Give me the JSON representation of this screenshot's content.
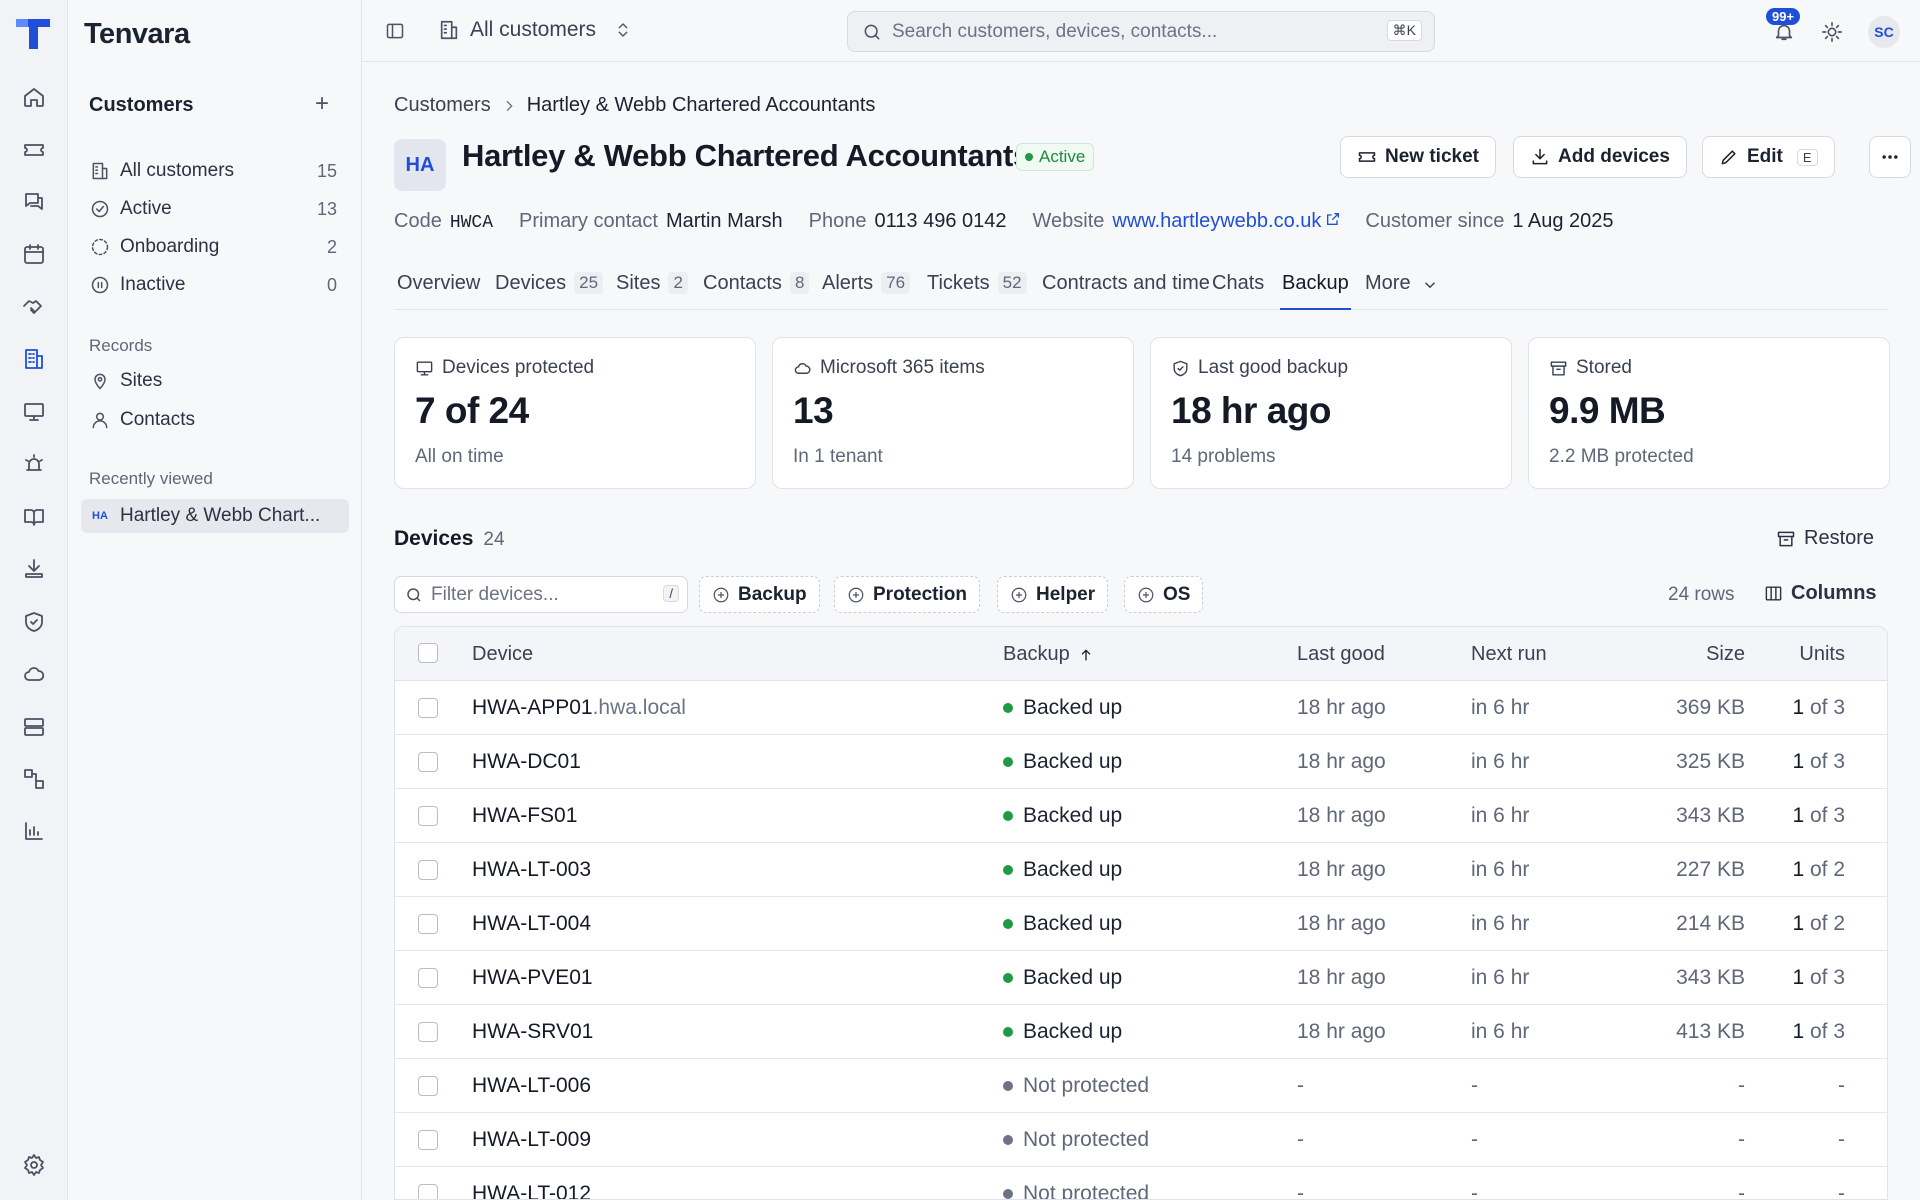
{
  "app": {
    "brand": "Tenvara"
  },
  "rail": {
    "icons": [
      "home-icon",
      "ticket-icon",
      "chat-icon",
      "calendar-icon",
      "handshake-icon",
      "building-icon",
      "monitor-icon",
      "alarm-icon",
      "book-icon",
      "download-icon",
      "shield-icon",
      "cloud-icon",
      "server-icon",
      "workflow-icon",
      "chart-icon",
      "settings-icon"
    ],
    "active": "building-icon"
  },
  "sidebar": {
    "title": "Customers",
    "items": [
      {
        "label": "All customers",
        "count": "15",
        "icon": "building-icon"
      },
      {
        "label": "Active",
        "count": "13",
        "icon": "check-circle-icon"
      },
      {
        "label": "Onboarding",
        "count": "2",
        "icon": "dashed-circle-icon"
      },
      {
        "label": "Inactive",
        "count": "0",
        "icon": "pause-circle-icon"
      }
    ],
    "records_label": "Records",
    "records": [
      {
        "label": "Sites",
        "icon": "pin-icon"
      },
      {
        "label": "Contacts",
        "icon": "user-icon"
      }
    ],
    "recent_label": "Recently viewed",
    "recent": [
      {
        "badge": "HA",
        "label": "Hartley & Webb Chart..."
      }
    ]
  },
  "topbar": {
    "scope": "All customers",
    "search_placeholder": "Search customers, devices, contacts...",
    "search_shortcut": "⌘K",
    "notifications_badge": "99+",
    "avatar": "SC"
  },
  "breadcrumb": {
    "root": "Customers",
    "current": "Hartley & Webb Chartered Accountants"
  },
  "customer": {
    "initials": "HA",
    "name": "Hartley & Webb Chartered Accountants",
    "status": "Active",
    "actions": {
      "new_ticket": "New ticket",
      "add_devices": "Add devices",
      "edit": "Edit",
      "edit_key": "E"
    },
    "meta": {
      "code_label": "Code",
      "code": "HWCA",
      "contact_label": "Primary contact",
      "contact": "Martin Marsh",
      "phone_label": "Phone",
      "phone": "0113 496 0142",
      "website_label": "Website",
      "website": "www.hartleywebb.co.uk",
      "since_label": "Customer since",
      "since": "1 Aug 2025"
    }
  },
  "tabs": [
    {
      "label": "Overview",
      "count": ""
    },
    {
      "label": "Devices",
      "count": "25"
    },
    {
      "label": "Sites",
      "count": "2"
    },
    {
      "label": "Contacts",
      "count": "8"
    },
    {
      "label": "Alerts",
      "count": "76"
    },
    {
      "label": "Tickets",
      "count": "52"
    },
    {
      "label": "Contracts and time",
      "count": ""
    },
    {
      "label": "Chats",
      "count": ""
    },
    {
      "label": "Backup",
      "count": ""
    },
    {
      "label": "More",
      "count": ""
    }
  ],
  "active_tab": "Backup",
  "stats": [
    {
      "label": "Devices protected",
      "value": "7 of 24",
      "sub": "All on time",
      "icon": "monitor-icon"
    },
    {
      "label": "Microsoft 365 items",
      "value": "13",
      "sub": "In 1 tenant",
      "icon": "cloud-icon"
    },
    {
      "label": "Last good backup",
      "value": "18 hr ago",
      "sub": "14 problems",
      "icon": "shield-check-icon"
    },
    {
      "label": "Stored",
      "value": "9.9 MB",
      "sub": "2.2 MB protected",
      "icon": "archive-icon"
    }
  ],
  "devices": {
    "title": "Devices",
    "count": "24",
    "restore_label": "Restore",
    "filter_placeholder": "Filter devices...",
    "filter_key": "/",
    "chips": [
      "Backup",
      "Protection",
      "Helper",
      "OS"
    ],
    "rows_label": "24 rows",
    "columns_label": "Columns",
    "headers": {
      "device": "Device",
      "backup": "Backup",
      "last_good": "Last good",
      "next_run": "Next run",
      "size": "Size",
      "units": "Units"
    },
    "status_colors": {
      "Backed up": "#1f9a45",
      "Not protected": "#6b7384"
    },
    "rows": [
      {
        "device": "HWA-APP01",
        "suffix": ".hwa.local",
        "backup": "Backed up",
        "last_good": "18 hr ago",
        "next_run": "in 6 hr",
        "size": "369 KB",
        "units_a": "1",
        "units_b": "of 3"
      },
      {
        "device": "HWA-DC01",
        "suffix": "",
        "backup": "Backed up",
        "last_good": "18 hr ago",
        "next_run": "in 6 hr",
        "size": "325 KB",
        "units_a": "1",
        "units_b": "of 3"
      },
      {
        "device": "HWA-FS01",
        "suffix": "",
        "backup": "Backed up",
        "last_good": "18 hr ago",
        "next_run": "in 6 hr",
        "size": "343 KB",
        "units_a": "1",
        "units_b": "of 3"
      },
      {
        "device": "HWA-LT-003",
        "suffix": "",
        "backup": "Backed up",
        "last_good": "18 hr ago",
        "next_run": "in 6 hr",
        "size": "227 KB",
        "units_a": "1",
        "units_b": "of 2"
      },
      {
        "device": "HWA-LT-004",
        "suffix": "",
        "backup": "Backed up",
        "last_good": "18 hr ago",
        "next_run": "in 6 hr",
        "size": "214 KB",
        "units_a": "1",
        "units_b": "of 2"
      },
      {
        "device": "HWA-PVE01",
        "suffix": "",
        "backup": "Backed up",
        "last_good": "18 hr ago",
        "next_run": "in 6 hr",
        "size": "343 KB",
        "units_a": "1",
        "units_b": "of 3"
      },
      {
        "device": "HWA-SRV01",
        "suffix": "",
        "backup": "Backed up",
        "last_good": "18 hr ago",
        "next_run": "in 6 hr",
        "size": "413 KB",
        "units_a": "1",
        "units_b": "of 3"
      },
      {
        "device": "HWA-LT-006",
        "suffix": "",
        "backup": "Not protected",
        "last_good": "-",
        "next_run": "-",
        "size": "-",
        "units_a": "",
        "units_b": "-"
      },
      {
        "device": "HWA-LT-009",
        "suffix": "",
        "backup": "Not protected",
        "last_good": "-",
        "next_run": "-",
        "size": "-",
        "units_a": "",
        "units_b": "-"
      },
      {
        "device": "HWA-LT-012",
        "suffix": "",
        "backup": "Not protected",
        "last_good": "-",
        "next_run": "-",
        "size": "-",
        "units_a": "",
        "units_b": "-"
      }
    ]
  }
}
